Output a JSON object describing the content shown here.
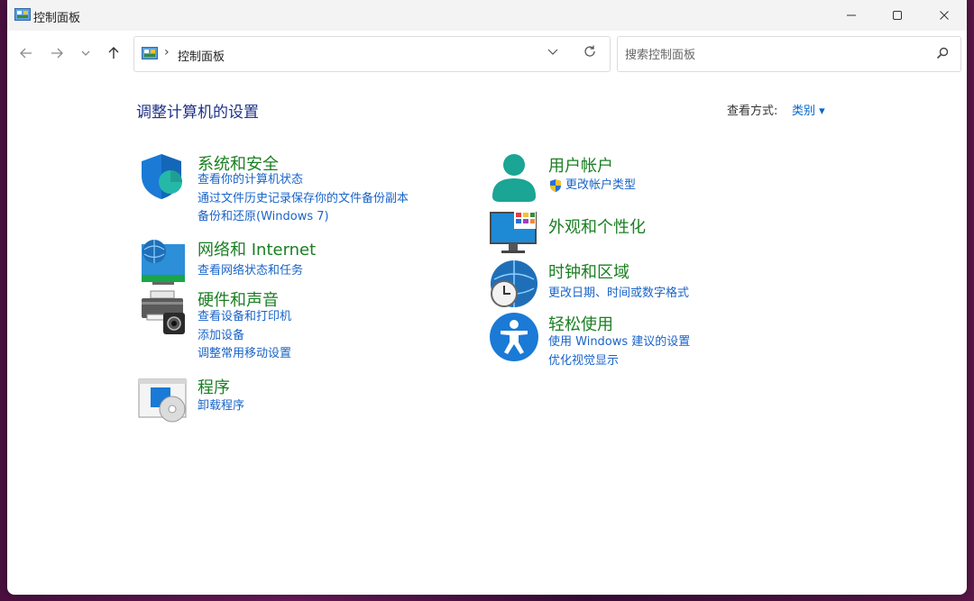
{
  "window": {
    "title": "控制面板",
    "minimize_icon": "minimize-icon",
    "maximize_icon": "maximize-icon",
    "close_icon": "close-icon"
  },
  "nav": {
    "back_icon": "arrow-left-icon",
    "forward_icon": "arrow-right-icon",
    "recent_icon": "chevron-down-icon",
    "up_icon": "arrow-up-icon"
  },
  "address": {
    "separator": "›",
    "path": "控制面板"
  },
  "search": {
    "placeholder": "搜索控制面板"
  },
  "main": {
    "heading": "调整计算机的设置",
    "view_by_label": "查看方式:",
    "view_by_value": "类别 ▾"
  },
  "categories_left": [
    {
      "icon": "shield-icon",
      "title": "系统和安全",
      "links": [
        "查看你的计算机状态",
        "通过文件历史记录保存你的文件备份副本",
        "备份和还原(Windows 7)"
      ]
    },
    {
      "icon": "network-globe-icon",
      "title": "网络和 Internet",
      "links": [
        "查看网络状态和任务"
      ]
    },
    {
      "icon": "printer-icon",
      "title": "硬件和声音",
      "links": [
        "查看设备和打印机",
        "添加设备",
        "调整常用移动设置"
      ]
    },
    {
      "icon": "programs-disc-icon",
      "title": "程序",
      "links": [
        "卸载程序"
      ]
    }
  ],
  "categories_right": [
    {
      "icon": "user-icon",
      "title": "用户帐户",
      "links": [
        "更改帐户类型"
      ]
    },
    {
      "icon": "monitor-icon",
      "title": "外观和个性化",
      "links": []
    },
    {
      "icon": "clock-globe-icon",
      "title": "时钟和区域",
      "links": [
        "更改日期、时间或数字格式"
      ]
    },
    {
      "icon": "accessibility-icon",
      "title": "轻松使用",
      "links": [
        "使用 Windows 建议的设置",
        "优化视觉显示"
      ]
    }
  ],
  "colors": {
    "heading": "#1e3287",
    "category_title": "#1a7f22",
    "link": "#1a64c8"
  }
}
